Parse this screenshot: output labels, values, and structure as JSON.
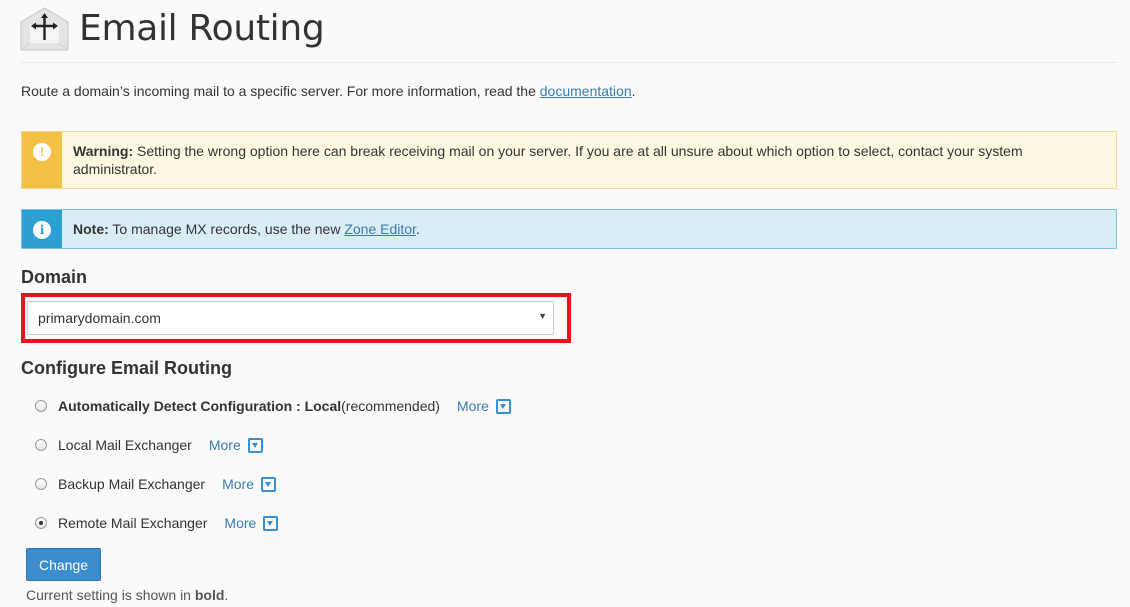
{
  "header": {
    "title": "Email Routing",
    "icon": "email-routing-icon"
  },
  "intro": {
    "text": "Route a domain’s incoming mail to a specific server. For more information, read the ",
    "link": "documentation",
    "suffix": "."
  },
  "warning": {
    "label": "Warning:",
    "text": " Setting the wrong option here can break receiving mail on your server. If you are at all unsure about which option to select, contact your system administrator.",
    "icon_glyph": "!",
    "color": "#f2c145"
  },
  "note": {
    "label": "Note:",
    "text": " To manage MX records, use the new ",
    "link": "Zone Editor",
    "suffix": ".",
    "icon_glyph": "i",
    "color": "#2d9fd2"
  },
  "domain": {
    "label": "Domain",
    "selected": "primarydomain.com",
    "highlight_color": "#e8131b"
  },
  "routing": {
    "label": "Configure Email Routing",
    "options": [
      {
        "bold": "Automatically Detect Configuration : Local",
        "suffix": " (recommended)",
        "more": "More",
        "checked": false
      },
      {
        "label": "Local Mail Exchanger",
        "more": "More",
        "checked": false
      },
      {
        "label": "Backup Mail Exchanger",
        "more": "More",
        "checked": false
      },
      {
        "label": "Remote Mail Exchanger",
        "more": "More",
        "checked": true
      }
    ]
  },
  "actions": {
    "change_label": "Change",
    "button_color": "#3c8dcd"
  },
  "footnote": {
    "prefix": "Current setting is shown in ",
    "bold": "bold",
    "suffix": "."
  }
}
